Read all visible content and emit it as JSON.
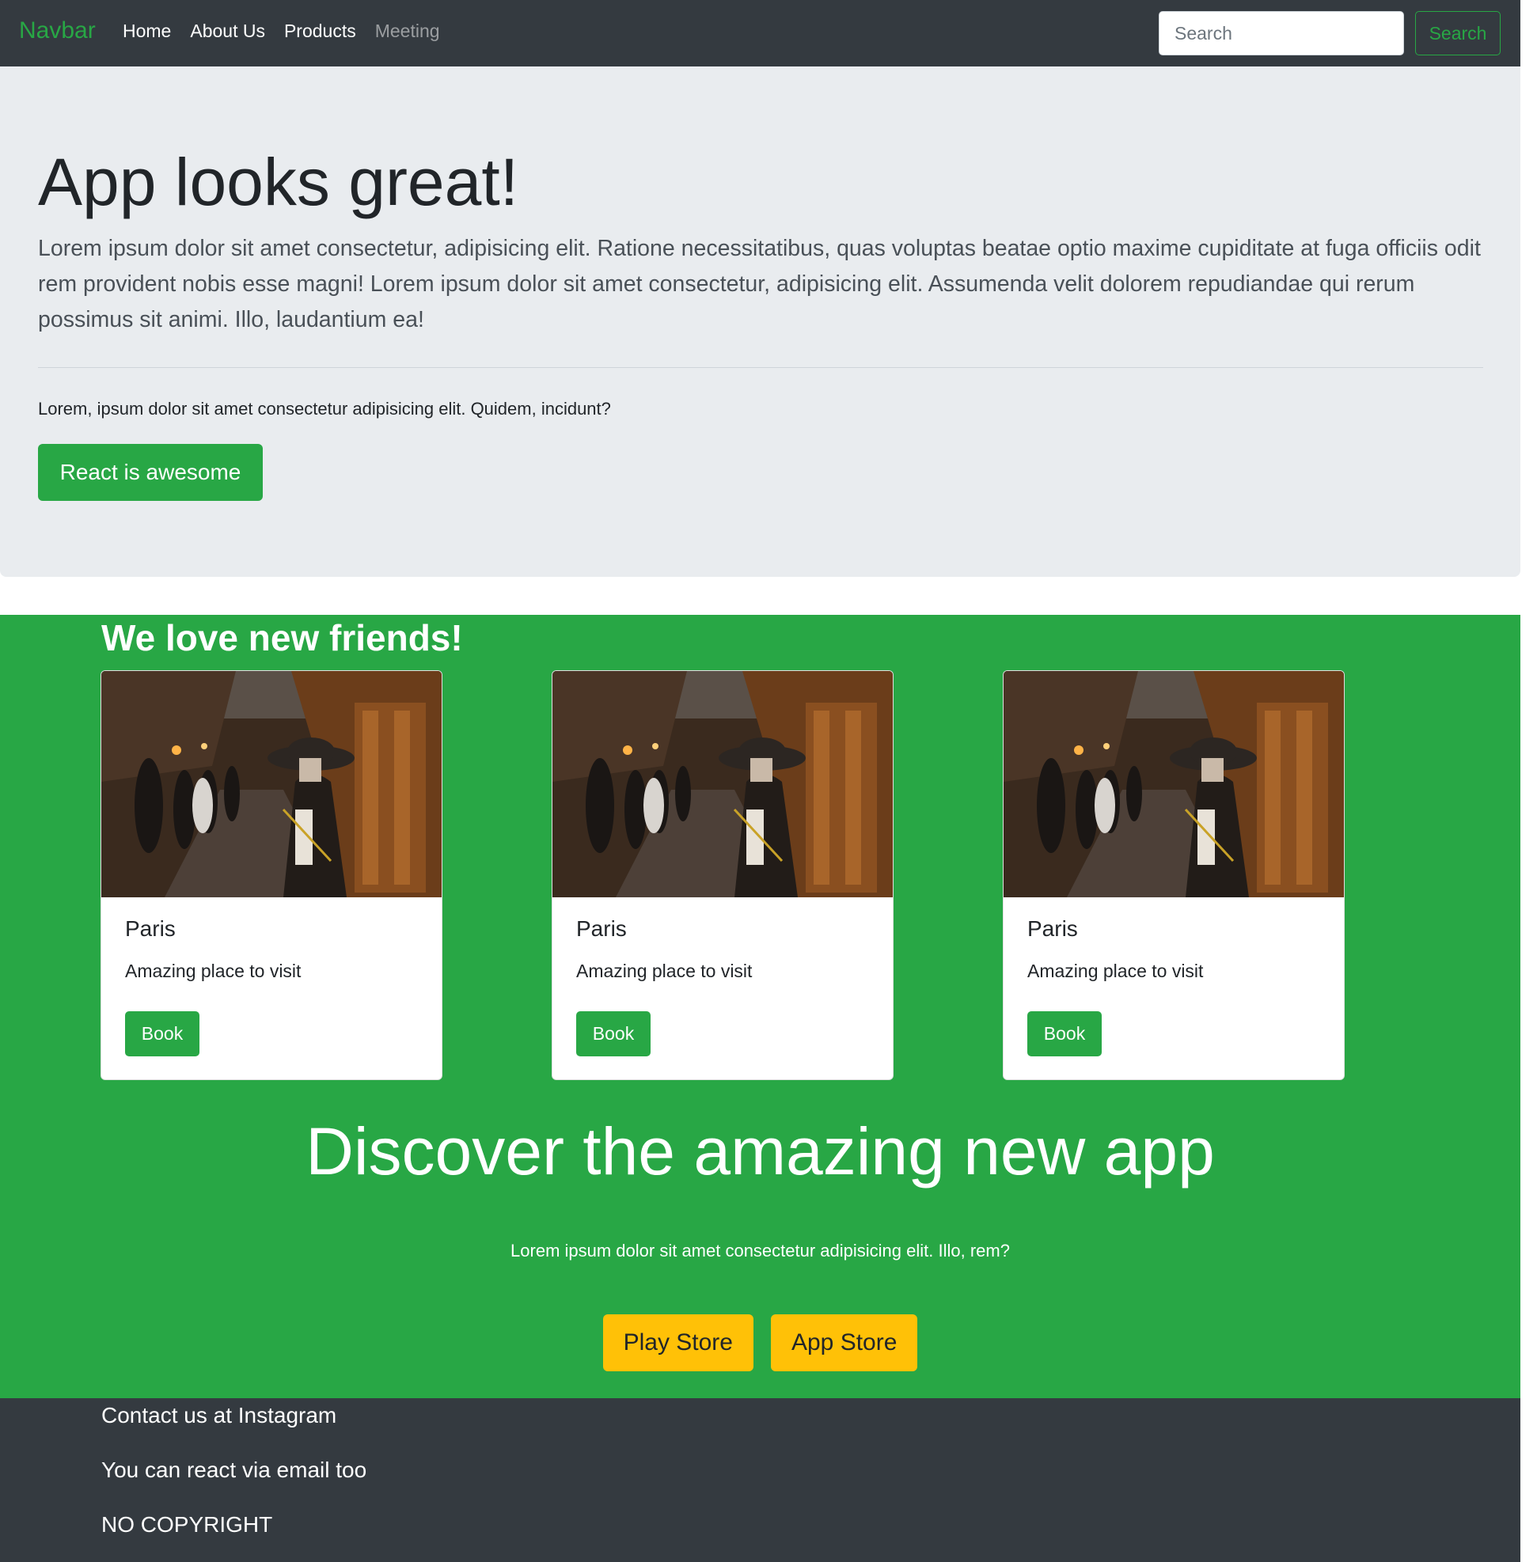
{
  "navbar": {
    "brand": "Navbar",
    "links": [
      "Home",
      "About Us",
      "Products",
      "Meeting"
    ],
    "search_placeholder": "Search",
    "search_button": "Search"
  },
  "jumbotron": {
    "title": "App looks great!",
    "lead": "Lorem ipsum dolor sit amet consectetur, adipisicing elit. Ratione necessitatibus, quas voluptas beatae optio maxime cupiditate at fuga officiis odit rem provident nobis esse magni! Lorem ipsum dolor sit amet consectetur, adipisicing elit. Assumenda velit dolorem repudiandae qui rerum possimus sit animi. Illo, laudantium ea!",
    "small_text": "Lorem, ipsum dolor sit amet consectetur adipisicing elit. Quidem, incidunt?",
    "button": "React is awesome"
  },
  "friends": {
    "title": "We love new friends!",
    "cards": [
      {
        "title": "Paris",
        "text": "Amazing place to visit",
        "button": "Book"
      },
      {
        "title": "Paris",
        "text": "Amazing place to visit",
        "button": "Book"
      },
      {
        "title": "Paris",
        "text": "Amazing place to visit",
        "button": "Book"
      }
    ]
  },
  "discover": {
    "title": "Discover the amazing new app",
    "text": "Lorem ipsum dolor sit amet consectetur adipisicing elit. Illo, rem?",
    "play_store": "Play Store",
    "app_store": "App Store"
  },
  "footer": {
    "contact": "Contact us at Instagram",
    "email": "You can react via email too",
    "copyright": "NO COPYRIGHT"
  },
  "colors": {
    "primary": "#28a745",
    "dark": "#343a40",
    "light": "#e9ecef",
    "warning": "#ffc107"
  }
}
